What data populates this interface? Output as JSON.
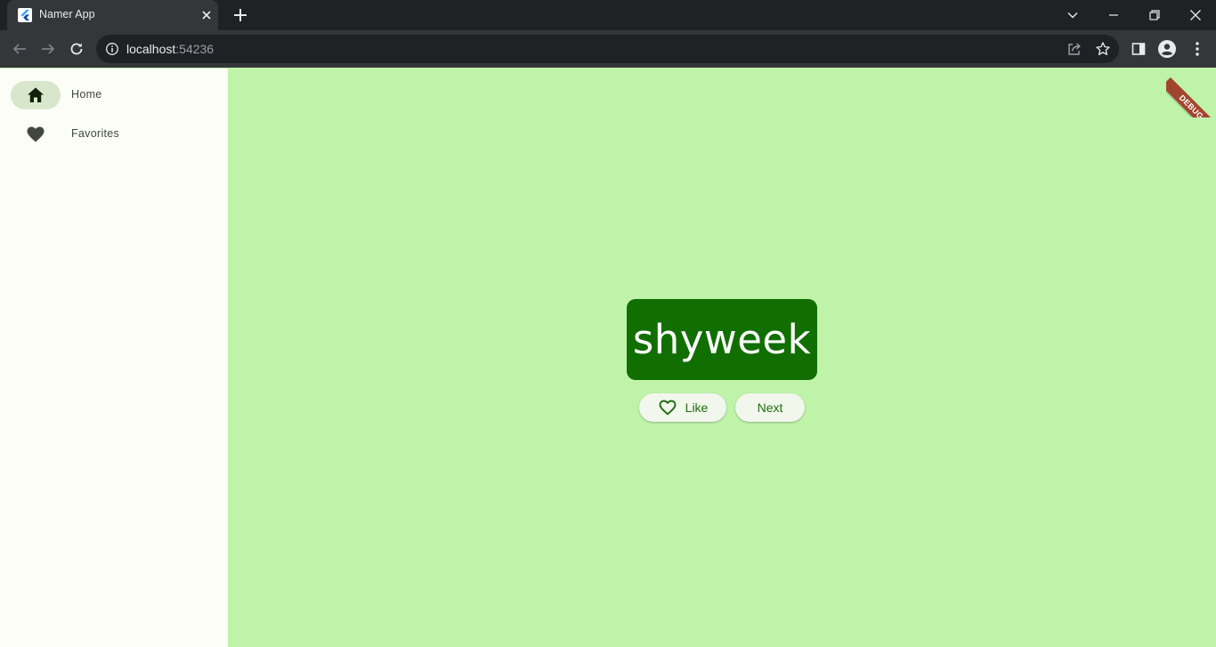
{
  "browser": {
    "tab": {
      "title": "Namer App"
    },
    "address": {
      "host": "localhost",
      "port": ":54236"
    }
  },
  "rail": {
    "items": [
      {
        "label": "Home",
        "icon": "home-icon",
        "selected": true
      },
      {
        "label": "Favorites",
        "icon": "favorite-icon",
        "selected": false
      }
    ]
  },
  "main": {
    "word": "shyweek",
    "like_label": "Like",
    "next_label": "Next"
  },
  "debug_banner": "DEBUG",
  "colors": {
    "background": "#bff3aa",
    "card": "#106f00",
    "rail_background": "#fbfdf6",
    "rail_indicator": "#d8e7cb",
    "button_text": "#1e6c10",
    "debug_ribbon": "#a2452f"
  }
}
